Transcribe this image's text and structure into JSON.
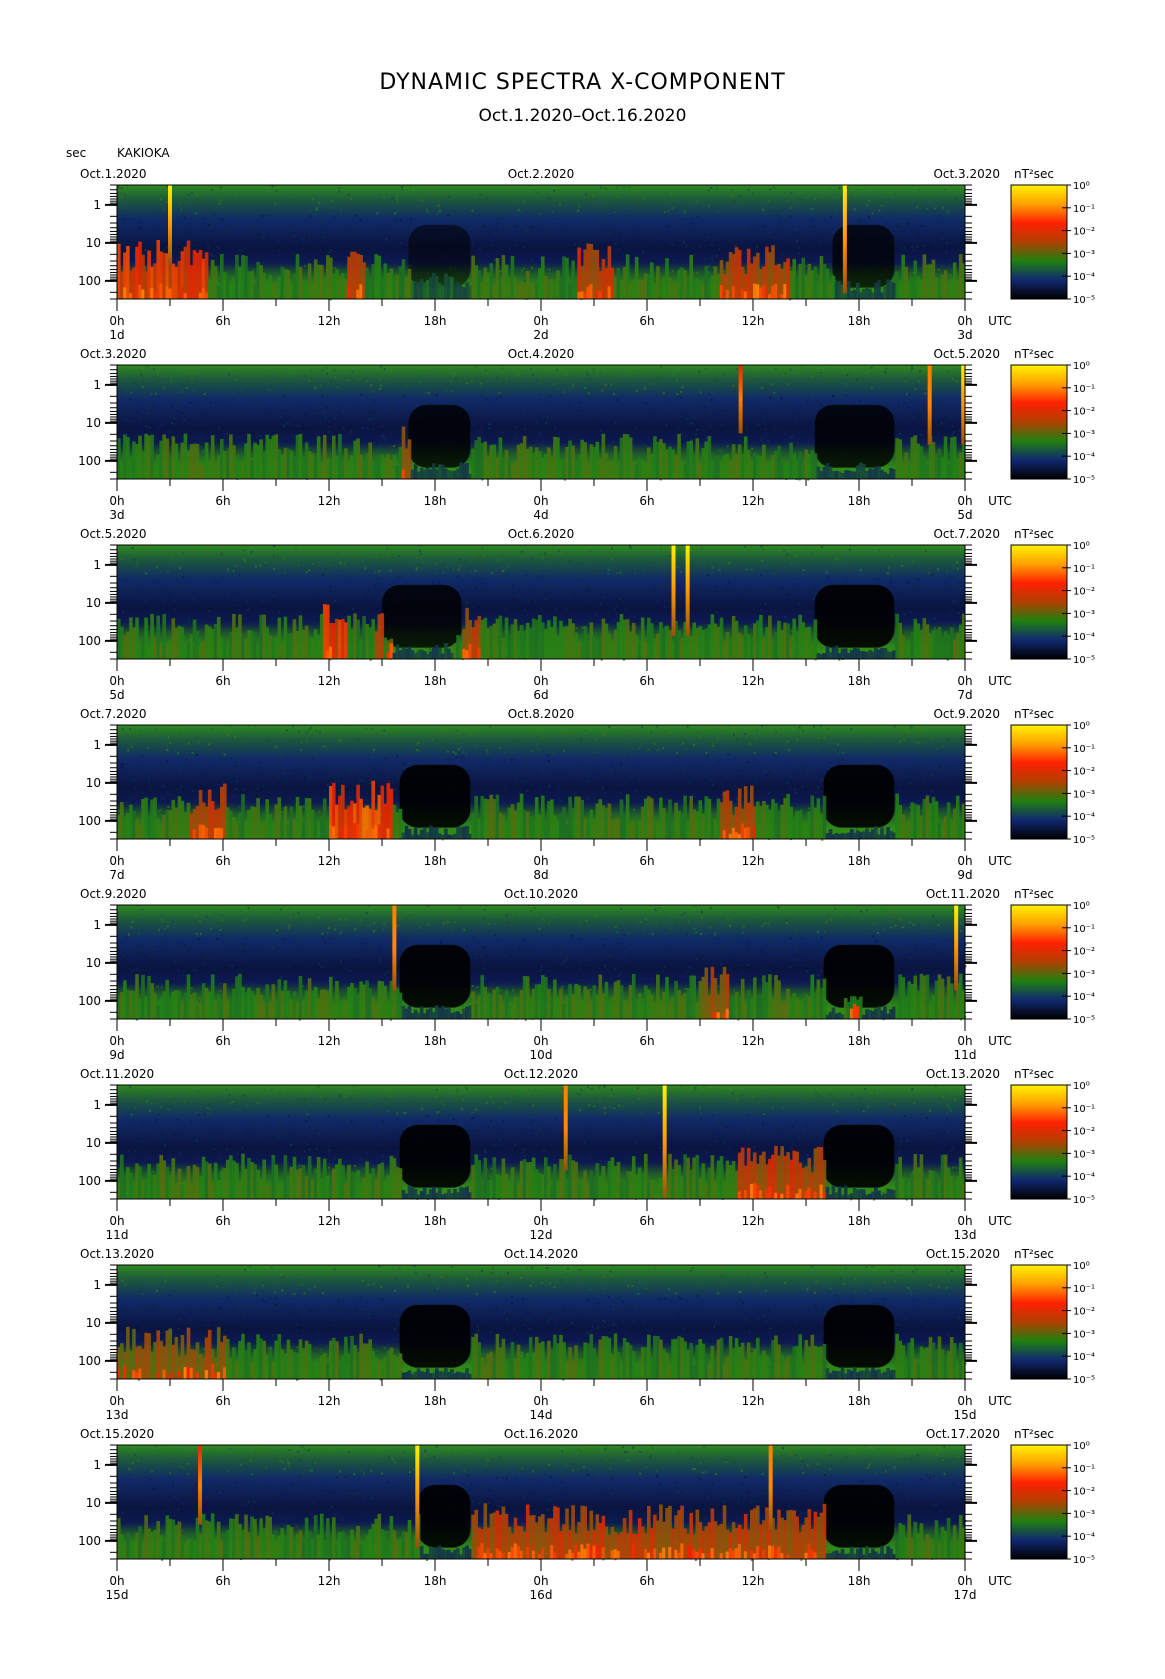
{
  "header": {
    "title": "DYNAMIC SPECTRA X-COMPONENT",
    "subtitle": "Oct.1.2020–Oct.16.2020",
    "unit": "sec",
    "station": "KAKIOKA"
  },
  "chart_data": {
    "type": "heatmap",
    "title": "DYNAMIC SPECTRA X-COMPONENT",
    "subtitle": "Oct.1.2020–Oct.16.2020",
    "station": "KAKIOKA",
    "ylabel": "sec",
    "y_scale": "log",
    "y_range_sec": [
      3,
      300
    ],
    "y_ticks": [
      "1",
      "10",
      "100"
    ],
    "x_ticks": [
      "0h",
      "6h",
      "12h",
      "18h",
      "0h",
      "6h",
      "12h",
      "18h",
      "0h"
    ],
    "x_unit": "UTC",
    "colorbar": {
      "unit": "nT²sec",
      "labels": [
        "10⁰",
        "10⁻¹",
        "10⁻²",
        "10⁻³",
        "10⁻⁴",
        "10⁻⁵"
      ],
      "colors": [
        "#fff200",
        "#ffa000",
        "#ff2000",
        "#b04000",
        "#208010",
        "#102870",
        "#000000"
      ]
    },
    "panels": [
      {
        "start": "Oct.1.2020",
        "mid": "Oct.2.2020",
        "end": "Oct.3.2020",
        "d0": "1d",
        "d1": "2d",
        "d2": "3d",
        "spikes": [
          {
            "hour": 3.0,
            "strength": 1.0,
            "extent": 0.7
          },
          {
            "hour": 41.2,
            "strength": 1.0,
            "extent": 0.95
          }
        ],
        "quiet": [
          {
            "from": 16.5,
            "to": 20.0,
            "depth": 0.6
          },
          {
            "from": 40.5,
            "to": 44.0,
            "depth": 0.8
          }
        ],
        "hot": [
          {
            "from": 0,
            "to": 5,
            "level": 0.8
          },
          {
            "from": 13,
            "to": 14,
            "level": 0.7
          },
          {
            "from": 26,
            "to": 28,
            "level": 0.6
          },
          {
            "from": 34,
            "to": 38,
            "level": 0.6
          }
        ]
      },
      {
        "start": "Oct.3.2020",
        "mid": "Oct.4.2020",
        "end": "Oct.5.2020",
        "d0": "3d",
        "d1": "4d",
        "d2": "5d",
        "spikes": [
          {
            "hour": 35.3,
            "strength": 0.8,
            "extent": 0.6
          },
          {
            "hour": 46.0,
            "strength": 0.9,
            "extent": 0.7
          },
          {
            "hour": 47.9,
            "strength": 1.0,
            "extent": 0.7
          }
        ],
        "quiet": [
          {
            "from": 16.5,
            "to": 20.0,
            "depth": 0.9
          },
          {
            "from": 39.5,
            "to": 44.0,
            "depth": 0.9
          }
        ],
        "hot": [
          {
            "from": 16,
            "to": 16.6,
            "level": 0.5
          }
        ]
      },
      {
        "start": "Oct.5.2020",
        "mid": "Oct.6.2020",
        "end": "Oct.7.2020",
        "d0": "5d",
        "d1": "6d",
        "d2": "7d",
        "spikes": [
          {
            "hour": 31.5,
            "strength": 1.0,
            "extent": 0.8
          },
          {
            "hour": 32.3,
            "strength": 1.0,
            "extent": 0.8
          }
        ],
        "quiet": [
          {
            "from": 15.0,
            "to": 19.5,
            "depth": 0.9
          },
          {
            "from": 39.5,
            "to": 44.0,
            "depth": 1.0
          }
        ],
        "hot": [
          {
            "from": 11.5,
            "to": 13,
            "level": 0.8
          },
          {
            "from": 14.5,
            "to": 15.5,
            "level": 0.7
          },
          {
            "from": 19,
            "to": 20.5,
            "level": 0.6
          }
        ]
      },
      {
        "start": "Oct.7.2020",
        "mid": "Oct.8.2020",
        "end": "Oct.9.2020",
        "d0": "7d",
        "d1": "8d",
        "d2": "9d",
        "spikes": [],
        "quiet": [
          {
            "from": 16.0,
            "to": 20.0,
            "depth": 1.0
          },
          {
            "from": 40.0,
            "to": 44.0,
            "depth": 1.0
          }
        ],
        "hot": [
          {
            "from": 4,
            "to": 6,
            "level": 0.6
          },
          {
            "from": 12,
            "to": 15.5,
            "level": 0.9
          },
          {
            "from": 34,
            "to": 36,
            "level": 0.6
          }
        ]
      },
      {
        "start": "Oct.9.2020",
        "mid": "Oct.10.2020",
        "end": "Oct.11.2020",
        "d0": "9d",
        "d1": "10d",
        "d2": "11d",
        "spikes": [
          {
            "hour": 15.7,
            "strength": 0.9,
            "extent": 0.75
          },
          {
            "hour": 47.5,
            "strength": 1.0,
            "extent": 0.75
          }
        ],
        "quiet": [
          {
            "from": 16.0,
            "to": 20.0,
            "depth": 1.0
          },
          {
            "from": 40.0,
            "to": 44.0,
            "depth": 1.0
          }
        ],
        "hot": [
          {
            "from": 33,
            "to": 34.5,
            "level": 0.5
          },
          {
            "from": 41,
            "to": 42,
            "level": 0.7
          }
        ]
      },
      {
        "start": "Oct.11.2020",
        "mid": "Oct.12.2020",
        "end": "Oct.13.2020",
        "d0": "11d",
        "d1": "12d",
        "d2": "13d",
        "spikes": [
          {
            "hour": 25.4,
            "strength": 0.9,
            "extent": 0.75
          },
          {
            "hour": 31.0,
            "strength": 1.0,
            "extent": 1.0
          }
        ],
        "quiet": [
          {
            "from": 16.0,
            "to": 20.0,
            "depth": 1.0
          },
          {
            "from": 40.0,
            "to": 44.0,
            "depth": 1.0
          }
        ],
        "hot": [
          {
            "from": 35,
            "to": 40,
            "level": 0.6
          }
        ]
      },
      {
        "start": "Oct.13.2020",
        "mid": "Oct.14.2020",
        "end": "Oct.15.2020",
        "d0": "13d",
        "d1": "14d",
        "d2": "15d",
        "spikes": [],
        "quiet": [
          {
            "from": 16.0,
            "to": 20.0,
            "depth": 1.0
          },
          {
            "from": 40.0,
            "to": 44.0,
            "depth": 1.0
          }
        ],
        "hot": [
          {
            "from": 0,
            "to": 6,
            "level": 0.4
          }
        ]
      },
      {
        "start": "Oct.15.2020",
        "mid": "Oct.16.2020",
        "end": "Oct.17.2020",
        "d0": "15d",
        "d1": "16d",
        "d2": "17d",
        "spikes": [
          {
            "hour": 4.7,
            "strength": 0.8,
            "extent": 0.7
          },
          {
            "hour": 17.0,
            "strength": 1.0,
            "extent": 0.9
          },
          {
            "hour": 37.0,
            "strength": 0.9,
            "extent": 0.75
          }
        ],
        "quiet": [
          {
            "from": 17.0,
            "to": 20.0,
            "depth": 1.0
          },
          {
            "from": 40.0,
            "to": 44.0,
            "depth": 1.0
          }
        ],
        "hot": [
          {
            "from": 20,
            "to": 40,
            "level": 0.6
          }
        ]
      }
    ]
  }
}
